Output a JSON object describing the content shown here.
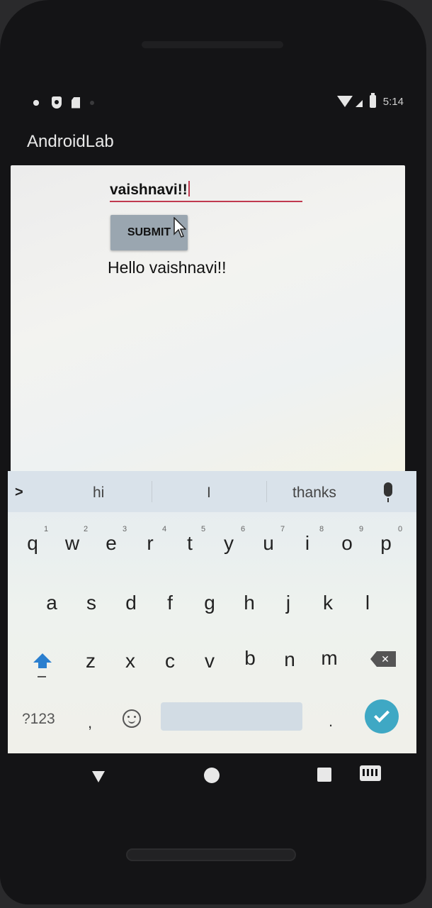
{
  "status_bar": {
    "time": "5:14"
  },
  "app_bar": {
    "title": "AndroidLab"
  },
  "main": {
    "input_value": "vaishnavi!!",
    "submit_label": "SUBMIT",
    "result_text": "Hello vaishnavi!!"
  },
  "keyboard": {
    "suggestions": [
      "hi",
      "I",
      "thanks"
    ],
    "row1": [
      {
        "key": "q",
        "hint": "1"
      },
      {
        "key": "w",
        "hint": "2"
      },
      {
        "key": "e",
        "hint": "3"
      },
      {
        "key": "r",
        "hint": "4"
      },
      {
        "key": "t",
        "hint": "5"
      },
      {
        "key": "y",
        "hint": "6"
      },
      {
        "key": "u",
        "hint": "7"
      },
      {
        "key": "i",
        "hint": "8"
      },
      {
        "key": "o",
        "hint": "9"
      },
      {
        "key": "p",
        "hint": "0"
      }
    ],
    "row2": [
      "a",
      "s",
      "d",
      "f",
      "g",
      "h",
      "j",
      "k",
      "l"
    ],
    "row3": [
      "z",
      "x",
      "c",
      "v",
      "b",
      "n",
      "m"
    ],
    "symbols_label": "?123",
    "comma": ",",
    "period": ".",
    "accent_color": "#3fa8c4"
  }
}
